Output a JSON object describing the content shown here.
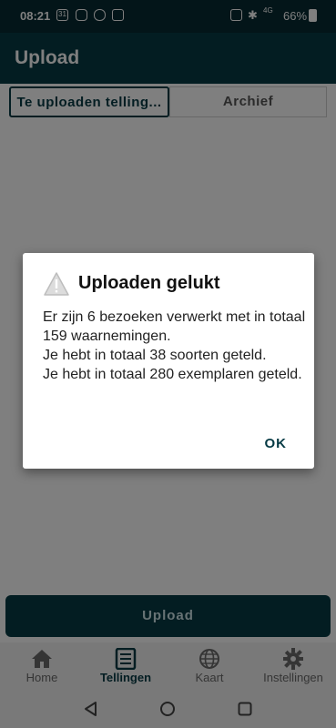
{
  "status_bar": {
    "time": "08:21",
    "calendar_icon_text": "31",
    "battery": "66%",
    "network": "4G"
  },
  "app_bar": {
    "title": "Upload"
  },
  "tabs": [
    {
      "label": "Te uploaden telling...",
      "active": true
    },
    {
      "label": "Archief",
      "active": false
    }
  ],
  "upload_button": {
    "label": "Upload"
  },
  "bottom_nav": [
    {
      "label": "Home",
      "icon": "home-icon",
      "active": false
    },
    {
      "label": "Tellingen",
      "icon": "list-icon",
      "active": true
    },
    {
      "label": "Kaart",
      "icon": "globe-icon",
      "active": false
    },
    {
      "label": "Instellingen",
      "icon": "gear-icon",
      "active": false
    }
  ],
  "dialog": {
    "title": "Uploaden gelukt",
    "message_lines": [
      "Er zijn 6 bezoeken verwerkt met in totaal 159 waarnemingen.",
      "Je hebt in totaal 38 soorten geteld.",
      "Je hebt in totaal 280 exemplaren geteld."
    ],
    "ok_label": "OK"
  },
  "colors": {
    "primary": "#063a44",
    "status_bar": "#062b33",
    "overlay": "rgba(0,0,0,0.5)"
  }
}
